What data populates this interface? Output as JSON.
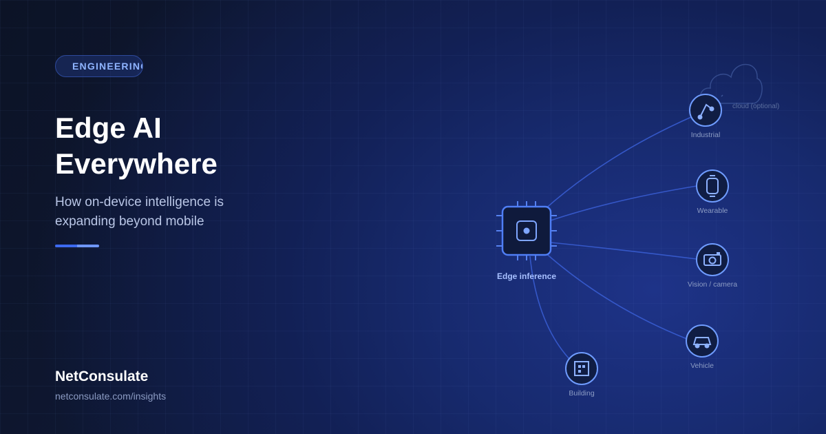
{
  "badge": "ENGINEERING",
  "title": {
    "line1": "Edge AI",
    "line2": "Everywhere"
  },
  "subtitle": {
    "line1": "How on-device intelligence is",
    "line2": "expanding beyond mobile"
  },
  "brand": "NetConsulate",
  "url": "netconsulate.com/insights",
  "diagram": {
    "hub_label": "Edge inference",
    "cloud_label": "cloud (optional)",
    "nodes": {
      "industrial": "Industrial",
      "wearable": "Wearable",
      "vision": "Vision / camera",
      "vehicle": "Vehicle",
      "building": "Building"
    }
  },
  "colors": {
    "accent": "#3d6af0",
    "node_stroke": "#6f9cff",
    "line": "#3a5fd6"
  }
}
